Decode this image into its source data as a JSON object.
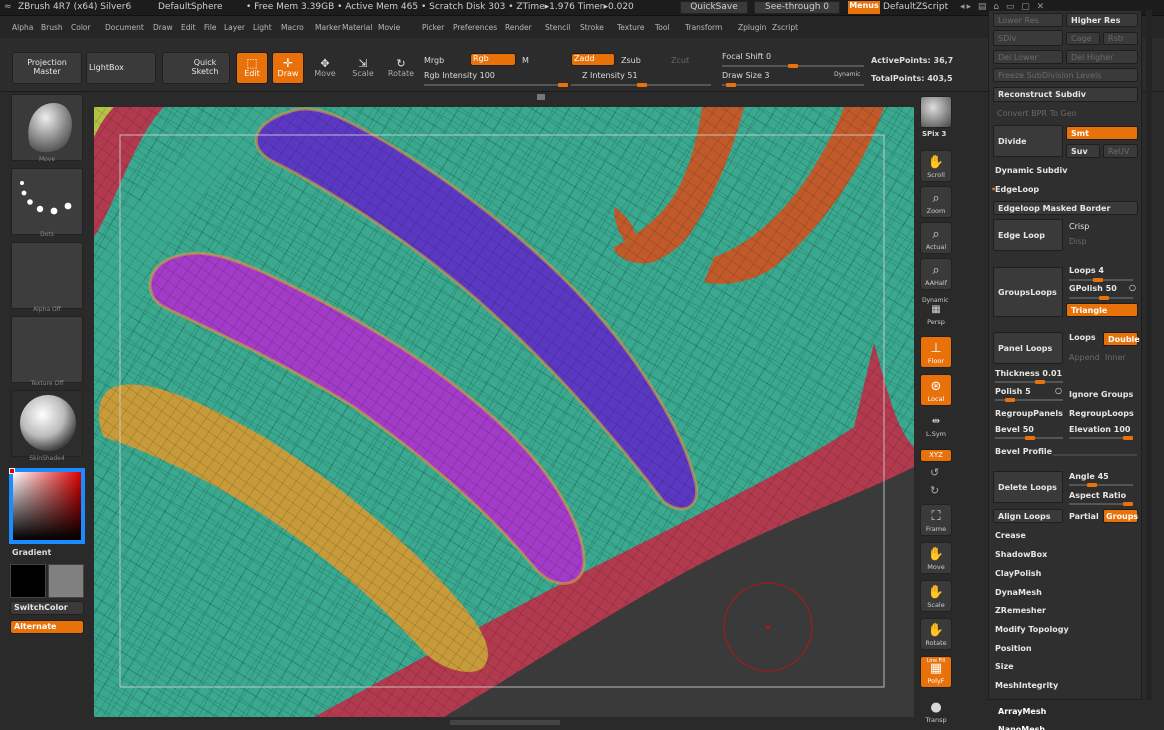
{
  "titlebar": {
    "app": "ZBrush 4R7 (x64) Silver6",
    "tool": "DefaultSphere",
    "stats": "• Free Mem 3.39GB • Active Mem 465 • Scratch Disk 303 • ZTime▸1.976 Timer▸0.020",
    "quicksave": "QuickSave",
    "seethrough": "See-through  0",
    "menus": "Menus",
    "script": "DefaultZScript"
  },
  "menubar": [
    "Alpha",
    "Brush",
    "Color",
    "Document",
    "Draw",
    "Edit",
    "File",
    "Layer",
    "Light",
    "Macro",
    "Marker",
    "Material",
    "Movie",
    "Picker",
    "Preferences",
    "Render",
    "Stencil",
    "Stroke",
    "Texture",
    "Tool",
    "Transform",
    "Zplugin",
    "Zscript"
  ],
  "toolbar": {
    "projection_master": "Projection Master",
    "lightbox": "LightBox",
    "quick_sketch": "Quick Sketch",
    "edit": "Edit",
    "draw": "Draw",
    "move": "Move",
    "scale": "Scale",
    "rotate": "Rotate",
    "mrgb": "Mrgb",
    "rgb": "Rgb",
    "m": "M",
    "rgb_intensity": "Rgb Intensity 100",
    "zadd": "Zadd",
    "zsub": "Zsub",
    "zcut": "Zcut",
    "z_intensity": "Z Intensity 51",
    "focal_shift": "Focal Shift 0",
    "draw_size": "Draw Size 3",
    "dynamic": "Dynamic",
    "active_points": "ActivePoints: 36,7",
    "total_points": "TotalPoints: 403,5",
    "rgb_intensity_value": 1.0,
    "z_intensity_value": 0.51,
    "draw_size_value": 0.03
  },
  "leftpanel": {
    "brush": "Move",
    "stroke": "Dots",
    "alpha": "Alpha  Off",
    "texture": "Texture  Off",
    "material": "SkinShade4",
    "gradient": "Gradient",
    "switchcolor": "SwitchColor",
    "alternate": "Alternate"
  },
  "rightshelf": {
    "spix": "SPix 3",
    "scroll": "Scroll",
    "zoom": "Zoom",
    "actual": "Actual",
    "aahalf": "AAHalf",
    "dynamic": "Dynamic",
    "persp": "Persp",
    "floor": "Floor",
    "local": "Local",
    "lsym": "L.Sym",
    "xyz": "XYZ",
    "frame": "Frame",
    "move": "Move",
    "scale": "Scale",
    "rotate": "Rotate",
    "linefill": "Line Fill",
    "polyf": "PolyF",
    "transp": "Transp"
  },
  "panel": {
    "lower_res": "Lower Res",
    "higher_res": "Higher Res",
    "sdiv": "SDiv",
    "cage": "Cage",
    "rstr": "Rstr",
    "del_lower": "Del Lower",
    "del_higher": "Del Higher",
    "freeze": "Freeze SubDivision Levels",
    "reconstruct": "Reconstruct Subdiv",
    "convert_bpr": "Convert BPR To Geo",
    "divide": "Divide",
    "smt": "Smt",
    "suv": "Suv",
    "reuv": "ReUV",
    "dynamic_subdiv": "Dynamic Subdiv",
    "edgeloop": "EdgeLoop",
    "edgeloop_masked": "Edgeloop Masked Border",
    "edge_loop": "Edge Loop",
    "crisp": "Crisp",
    "disp": "Disp",
    "groupsloops": "GroupsLoops",
    "loops": "Loops 4",
    "gpolish": "GPolish 50",
    "triangle": "Triangle",
    "panel_loops": "Panel Loops",
    "loops2": "Loops",
    "double": "Double",
    "append": "Append",
    "inner": "Inner",
    "thickness": "Thickness 0.01",
    "polish": "Polish 5",
    "ignore_groups": "Ignore Groups",
    "regroup_panels": "RegroupPanels",
    "regroup_loops": "RegroupLoops",
    "bevel": "Bevel 50",
    "elevation": "Elevation 100",
    "bevel_profile": "Bevel Profile",
    "delete_loops": "Delete Loops",
    "angle": "Angle 45",
    "aspect_ratio": "Aspect Ratio",
    "align_loops": "Align Loops",
    "partial": "Partial",
    "groups": "Groups",
    "crease": "Crease",
    "shadowbox": "ShadowBox",
    "claypolish": "ClayPolish",
    "dynamesh": "DynaMesh",
    "zremesher": "ZRemesher",
    "modify_topology": "Modify Topology",
    "position": "Position",
    "size": "Size",
    "meshintegrity": "MeshIntegrity",
    "arraymesh": "ArrayMesh",
    "nanomesh": "NanoMesh"
  },
  "colors": {
    "accent": "#e8710a",
    "teal": "#3aa98f",
    "purple": "#a23bc7",
    "indigo": "#5b38c2",
    "mustard": "#c79a3a",
    "crimson": "#b23a4e",
    "rust": "#c15a2a"
  }
}
